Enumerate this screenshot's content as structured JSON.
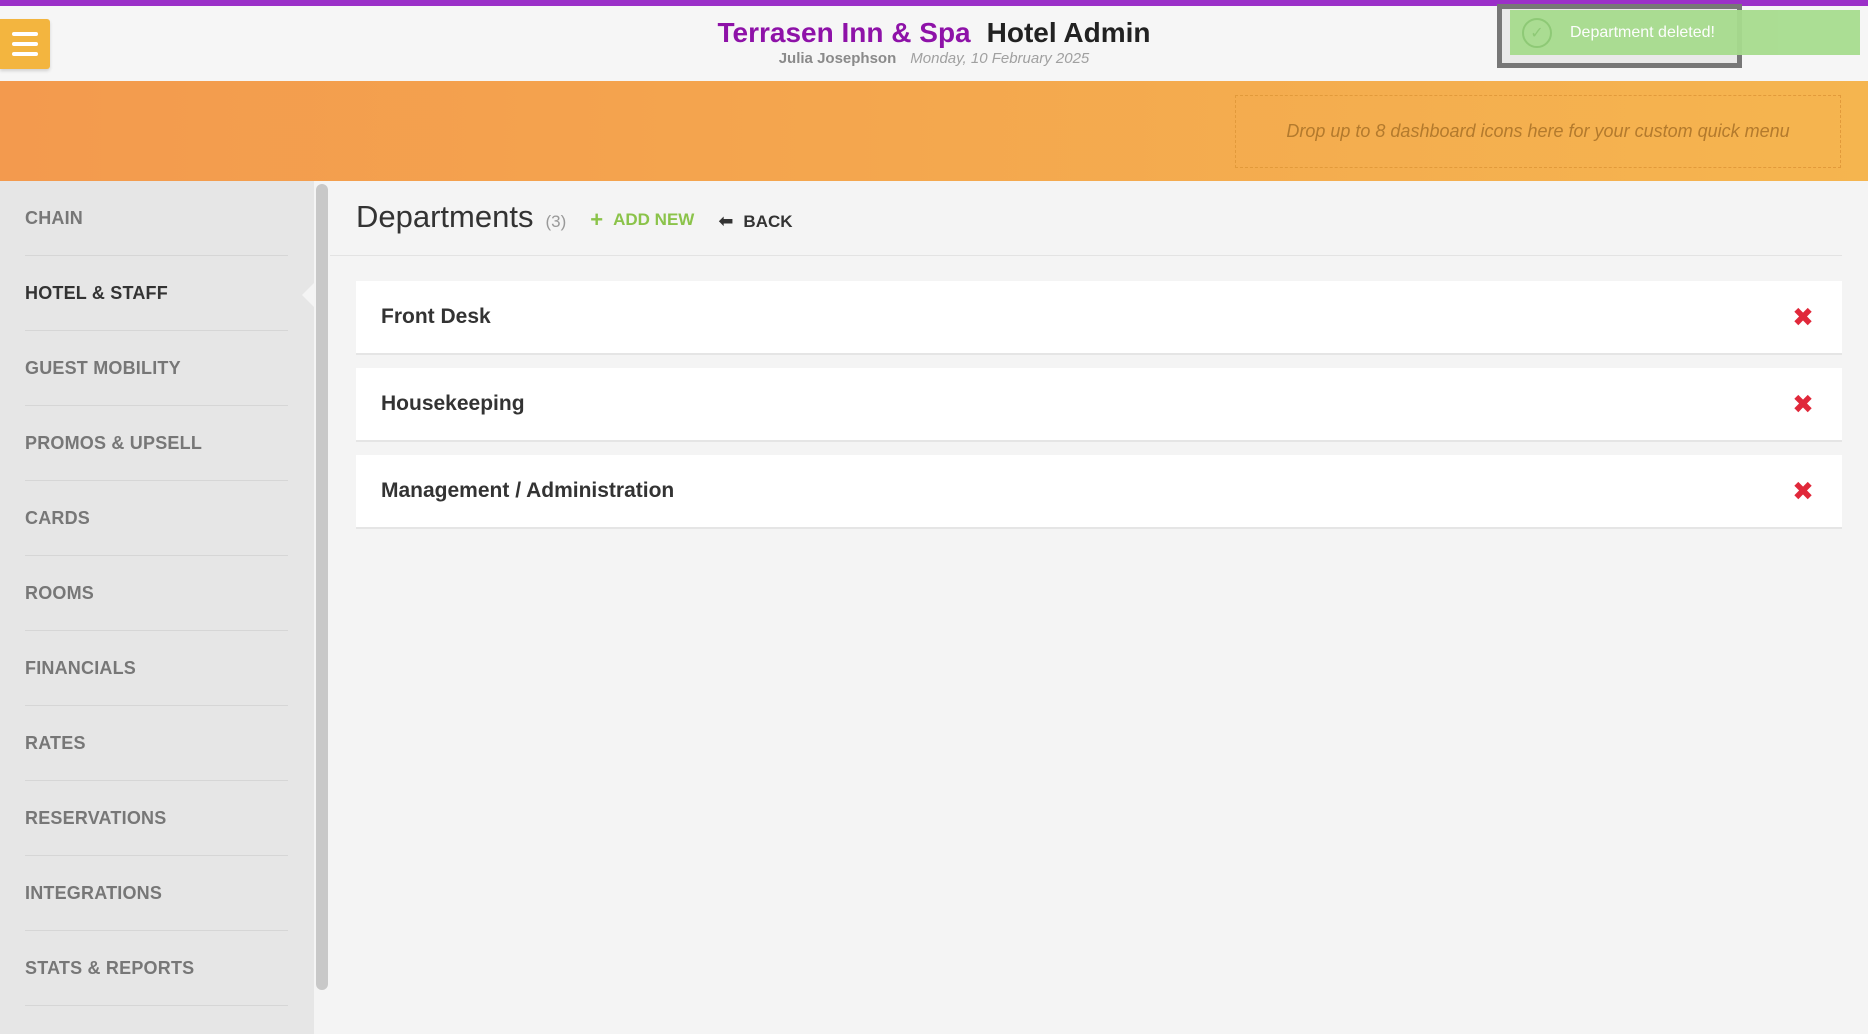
{
  "header": {
    "hotel_name": "Terrasen Inn & Spa",
    "app_label": "Hotel Admin",
    "user_name": "Julia Josephson",
    "date": "Monday, 10 February 2025"
  },
  "toast": {
    "message": "Department deleted!",
    "icon": "check-circle-icon"
  },
  "banner": {
    "dropzone_text": "Drop up to 8 dashboard icons here for your custom quick menu"
  },
  "sidebar": {
    "items": [
      {
        "label": "CHAIN"
      },
      {
        "label": "HOTEL & STAFF"
      },
      {
        "label": "GUEST MOBILITY"
      },
      {
        "label": "PROMOS & UPSELL"
      },
      {
        "label": "CARDS"
      },
      {
        "label": "ROOMS"
      },
      {
        "label": "FINANCIALS"
      },
      {
        "label": "RATES"
      },
      {
        "label": "RESERVATIONS"
      },
      {
        "label": "INTEGRATIONS"
      },
      {
        "label": "STATS & REPORTS"
      }
    ],
    "active_index": 1
  },
  "main": {
    "title": "Departments",
    "count": "(3)",
    "add_new_label": "ADD NEW",
    "back_label": "BACK",
    "departments": [
      {
        "name": "Front Desk"
      },
      {
        "name": "Housekeeping"
      },
      {
        "name": "Management / Administration"
      }
    ]
  },
  "colors": {
    "accent_purple": "#8e12a8",
    "menu_orange": "#f3b53f",
    "banner_start": "#f39a4e",
    "banner_end": "#f5b54f",
    "add_green": "#8bc34a",
    "delete_red": "#e0283a",
    "toast_green": "#a7dc8e"
  }
}
